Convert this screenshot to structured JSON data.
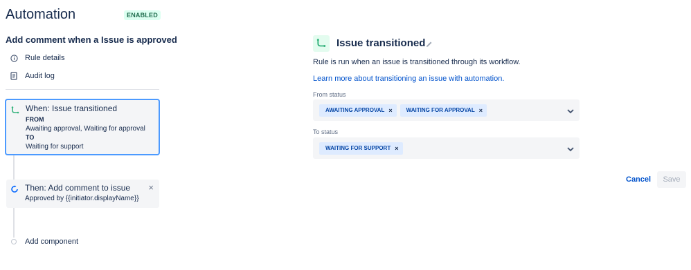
{
  "header": {
    "title": "Automation",
    "status": "ENABLED"
  },
  "rule": {
    "name": "Add comment when a Issue is approved"
  },
  "nav": {
    "rule_details": "Rule details",
    "audit_log": "Audit log"
  },
  "trigger": {
    "title": "When: Issue transitioned",
    "from_label": "FROM",
    "from_value": "Awaiting approval, Waiting for approval",
    "to_label": "TO",
    "to_value": "Waiting for support"
  },
  "action": {
    "title": "Then: Add comment to issue",
    "subtitle": "Approved by {{initiator.displayName}}",
    "close": "×"
  },
  "add_component": "Add component",
  "panel": {
    "title": "Issue transitioned",
    "description": "Rule is run when an issue is transitioned through its workflow.",
    "link": "Learn more about transitioning an issue with automation.",
    "from_label": "From status",
    "from_tags": [
      "AWAITING APPROVAL",
      "WAITING FOR APPROVAL"
    ],
    "to_label": "To status",
    "to_tags": [
      "WAITING FOR SUPPORT"
    ],
    "tag_remove": "×"
  },
  "buttons": {
    "cancel": "Cancel",
    "save": "Save"
  },
  "colors": {
    "accent": "#0052cc",
    "trigger_green": "#36b37e",
    "action_blue": "#0065ff",
    "tag_bg": "#deebff",
    "tag_text": "#0747a6",
    "enabled_bg": "#dcfff1",
    "enabled_text": "#216e4e"
  },
  "icons": {
    "info": "info-icon",
    "audit": "document-icon",
    "trigger": "transition-icon",
    "action": "comment-action-icon",
    "edit": "pencil-icon",
    "chevron": "chevron-down-icon"
  }
}
